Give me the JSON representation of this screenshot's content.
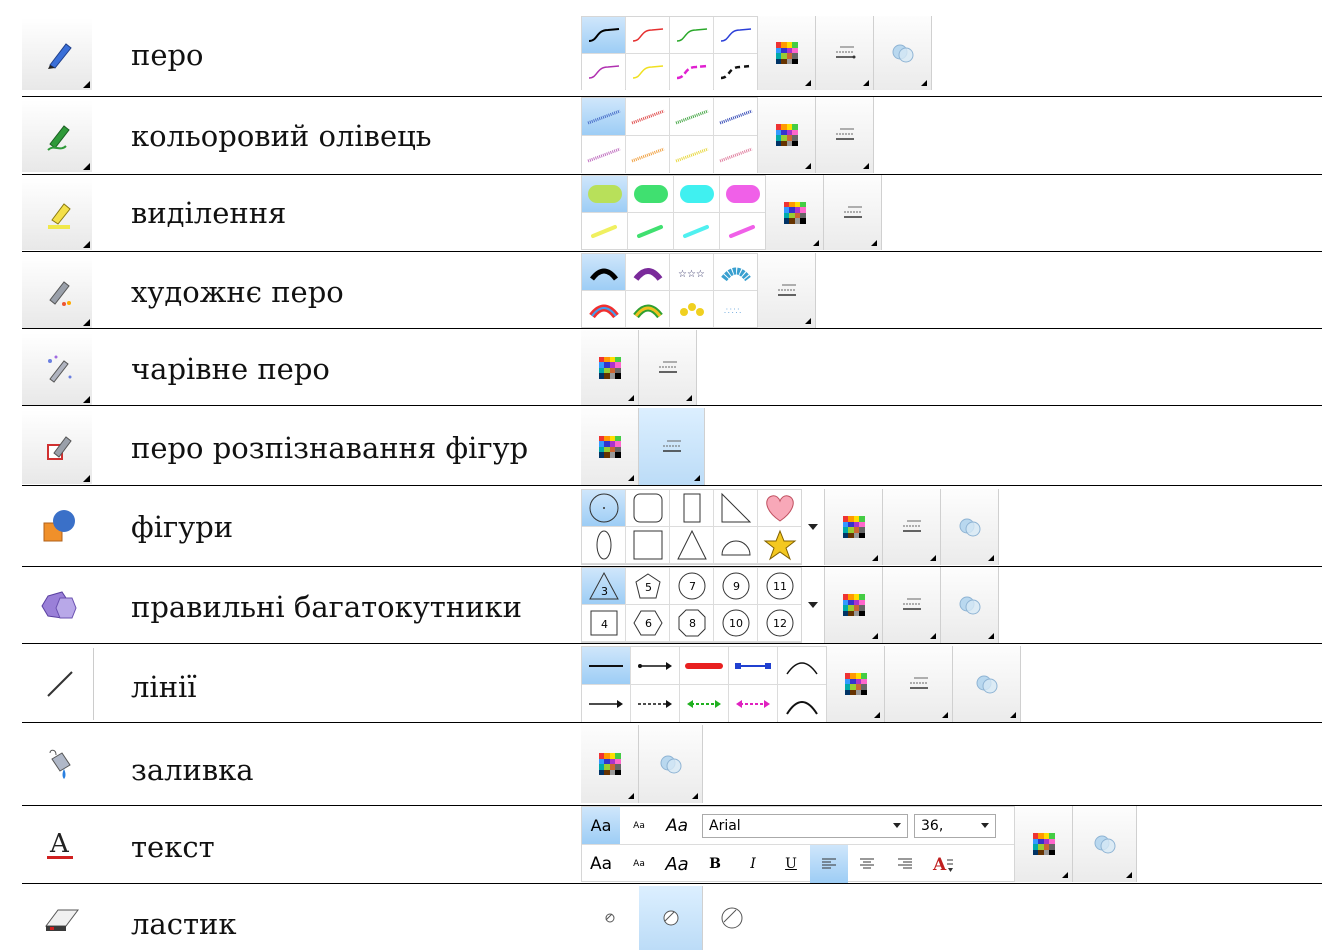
{
  "tools": [
    {
      "icon": "pen-icon",
      "label": "перо"
    },
    {
      "icon": "crayon-icon",
      "label": "кольоровий олівець"
    },
    {
      "icon": "highlighter-icon",
      "label": "виділення"
    },
    {
      "icon": "artistic-pen-icon",
      "label": "художнє перо"
    },
    {
      "icon": "magic-pen-icon",
      "label": "чарівне перо"
    },
    {
      "icon": "shape-recognition-pen-icon",
      "label": "перо розпізнавання фігур"
    },
    {
      "icon": "shapes-icon",
      "label": "фігури"
    },
    {
      "icon": "regular-polygons-icon",
      "label": "правильні багатокутники"
    },
    {
      "icon": "lines-icon",
      "label": "лінії"
    },
    {
      "icon": "fill-icon",
      "label": "заливка"
    },
    {
      "icon": "text-icon",
      "label": "текст"
    },
    {
      "icon": "eraser-icon",
      "label": "ластик"
    }
  ],
  "polygon_sides": [
    "3",
    "5",
    "7",
    "9",
    "11",
    "4",
    "6",
    "8",
    "10",
    "12"
  ],
  "text_toolbar": {
    "font_name": "Arial",
    "font_size": "36,",
    "style_sample_1": "Aa",
    "style_sample_2": "Aa",
    "style_sample_3": "Aa",
    "bold": "B",
    "italic": "I",
    "underline": "U"
  },
  "colors": {
    "selected_cell": "#9dcdf5",
    "separator": "#000000"
  }
}
